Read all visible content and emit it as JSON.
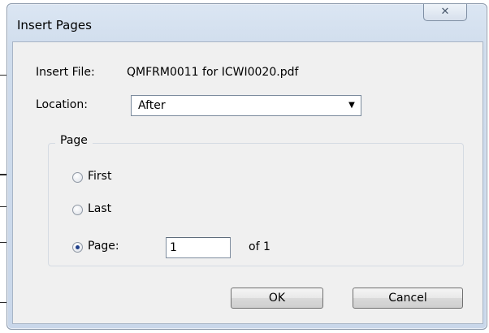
{
  "dialog": {
    "title": "Insert Pages",
    "close_glyph": "✕"
  },
  "insert_file": {
    "label": "Insert File:",
    "filename": "QMFRM0011 for ICWI0020.pdf"
  },
  "location": {
    "label": "Location:",
    "selected": "After",
    "dropdown_icon": "chevron-down-icon"
  },
  "page_group": {
    "label": "Page",
    "options": [
      {
        "label": "First",
        "checked": false
      },
      {
        "label": "Last",
        "checked": false
      },
      {
        "label": "Page:",
        "checked": true
      }
    ],
    "page_value": "1",
    "of_total": "of 1"
  },
  "buttons": {
    "ok": "OK",
    "cancel": "Cancel"
  }
}
